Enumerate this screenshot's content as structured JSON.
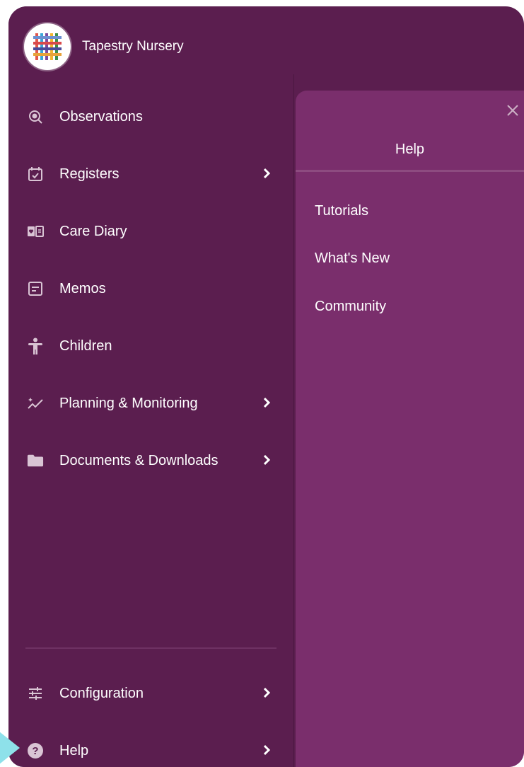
{
  "brand": {
    "name": "Tapestry Nursery"
  },
  "nav": {
    "observations": "Observations",
    "registers": "Registers",
    "care_diary": "Care Diary",
    "memos": "Memos",
    "children": "Children",
    "planning": "Planning & Monitoring",
    "documents": "Documents & Downloads",
    "configuration": "Configuration",
    "help": "Help"
  },
  "panel": {
    "title": "Help",
    "links": [
      "Tutorials",
      "What's New",
      "Community"
    ]
  },
  "colors": {
    "sidebar_bg": "#5b1e4f",
    "panel_bg": "#7a2e6c",
    "pointer": "#8ee1ea"
  }
}
